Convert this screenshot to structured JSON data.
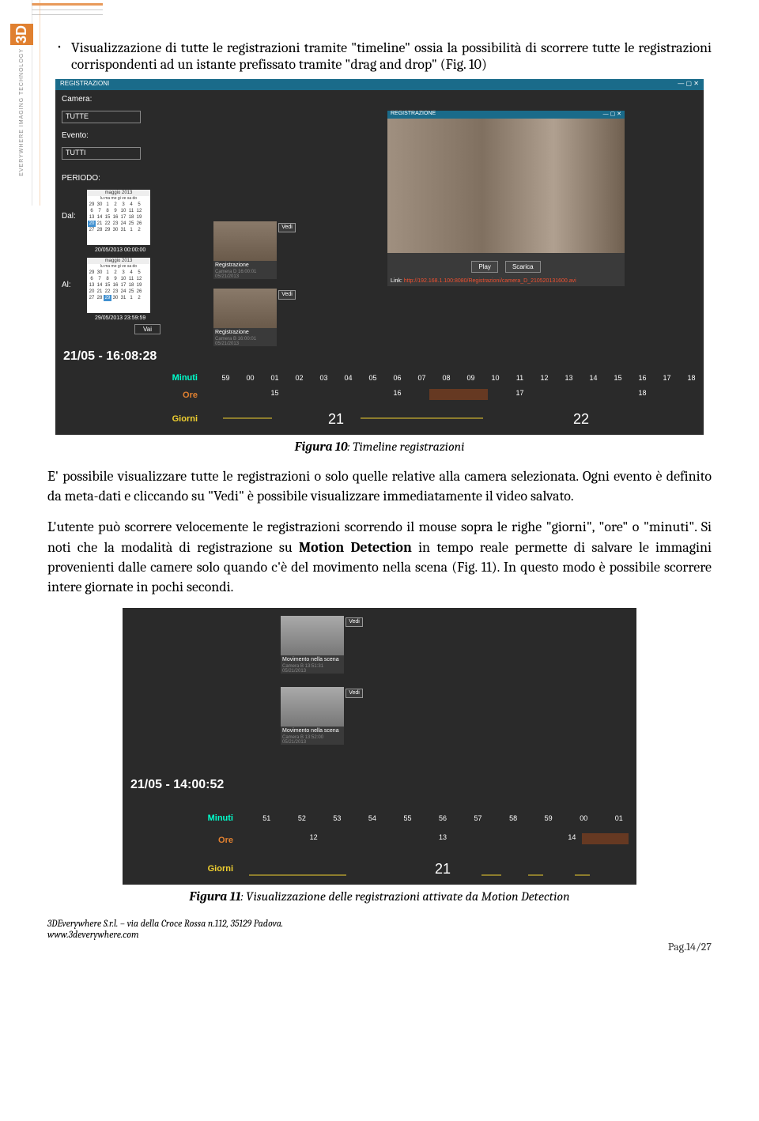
{
  "sidebar": {
    "logo": "3D",
    "tagline": "EVERYWHERE IMAGING TECHNOLOGY"
  },
  "bullet_text": "Visualizzazione di tutte le registrazioni tramite \"timeline\" ossia la possibilità di scorrere tutte le registrazioni corrispondenti ad un istante prefissato tramite \"drag and drop\" (Fig. 10)",
  "fig1": {
    "title": "REGISTRAZIONI",
    "camera_label": "Camera:",
    "camera_value": "TUTTE",
    "evento_label": "Evento:",
    "evento_value": "TUTTI",
    "periodo_label": "PERIODO:",
    "dal_label": "Dal:",
    "al_label": "Al:",
    "cal_head": "maggio 2013",
    "cal_dow": "lu ma me gi ve sa do",
    "cal_date1": "20/05/2013 00:00:00",
    "cal_date2": "29/05/2013 23:59:59",
    "vai_btn": "Vai",
    "thumb1_btn": "Vedi",
    "thumb1_label": "Registrazione",
    "thumb1_meta": "Camera D  16:00:01 05/21/2013",
    "thumb2_btn": "Vedi",
    "thumb2_label": "Registrazione",
    "thumb2_meta": "Camera B  16:00:01 05/21/2013",
    "preview_title": "REGISTRAZIONE",
    "play_btn": "Play",
    "scarica_btn": "Scarica",
    "link_label": "Link:",
    "link_url": "http://192.168.1.100:8080/Registrazioni/camera_D_210520131600.avi",
    "timestamp": "21/05 - 16:08:28",
    "minuti_label": "Minuti",
    "ore_label": "Ore",
    "giorni_label": "Giorni",
    "minuti_ticks": [
      "59",
      "00",
      "01",
      "02",
      "03",
      "04",
      "05",
      "06",
      "07",
      "08",
      "09",
      "10",
      "11",
      "12",
      "13",
      "14",
      "15",
      "16",
      "17",
      "18"
    ],
    "ore_ticks": [
      "15",
      "16",
      "17",
      "18"
    ],
    "giorni_ticks": [
      "21",
      "22"
    ]
  },
  "caption1_bold": "Figura 10",
  "caption1_rest": ": Timeline registrazioni",
  "para1": "E' possibile visualizzare tutte le registrazioni o solo quelle relative alla camera selezionata. Ogni evento è definito da meta-dati e cliccando su \"Vedi\" è possibile visualizzare immediatamente il video salvato.",
  "para2_a": "L'utente può scorrere velocemente le registrazioni scorrendo il mouse sopra le righe \"giorni\", \"ore\" o \"minuti\". Si noti che la modalità di registrazione su ",
  "para2_b": "Motion Detection",
  "para2_c": " in tempo reale permette di salvare le immagini provenienti dalle camere solo quando c'è del movimento nella scena (Fig. 11). In questo modo è possibile scorrere intere giornate in pochi secondi.",
  "fig2": {
    "thumb1_btn": "Vedi",
    "thumb1_label": "Movimento nella scena",
    "thumb1_meta": "Camera B  13:51:31 05/21/2013",
    "thumb2_btn": "Vedi",
    "thumb2_label": "Movimento nella scena",
    "thumb2_meta": "Camera B  13:52:00 05/21/2013",
    "timestamp": "21/05 - 14:00:52",
    "minuti_label": "Minuti",
    "ore_label": "Ore",
    "giorni_label": "Giorni",
    "minuti_ticks": [
      "51",
      "52",
      "53",
      "54",
      "55",
      "56",
      "57",
      "58",
      "59",
      "00",
      "01"
    ],
    "ore_ticks": [
      "12",
      "13",
      "14"
    ],
    "giorni_ticks": [
      "21"
    ]
  },
  "caption2_bold": "Figura 11",
  "caption2_rest": ": Visualizzazione delle registrazioni attivate da Motion Detection",
  "footer": {
    "line1": "3DEverywhere S.r.l. – via della Croce Rossa n.112,  35129 Padova.",
    "line2": "www.3deverywhere.com",
    "page": "Pag.14/27"
  }
}
